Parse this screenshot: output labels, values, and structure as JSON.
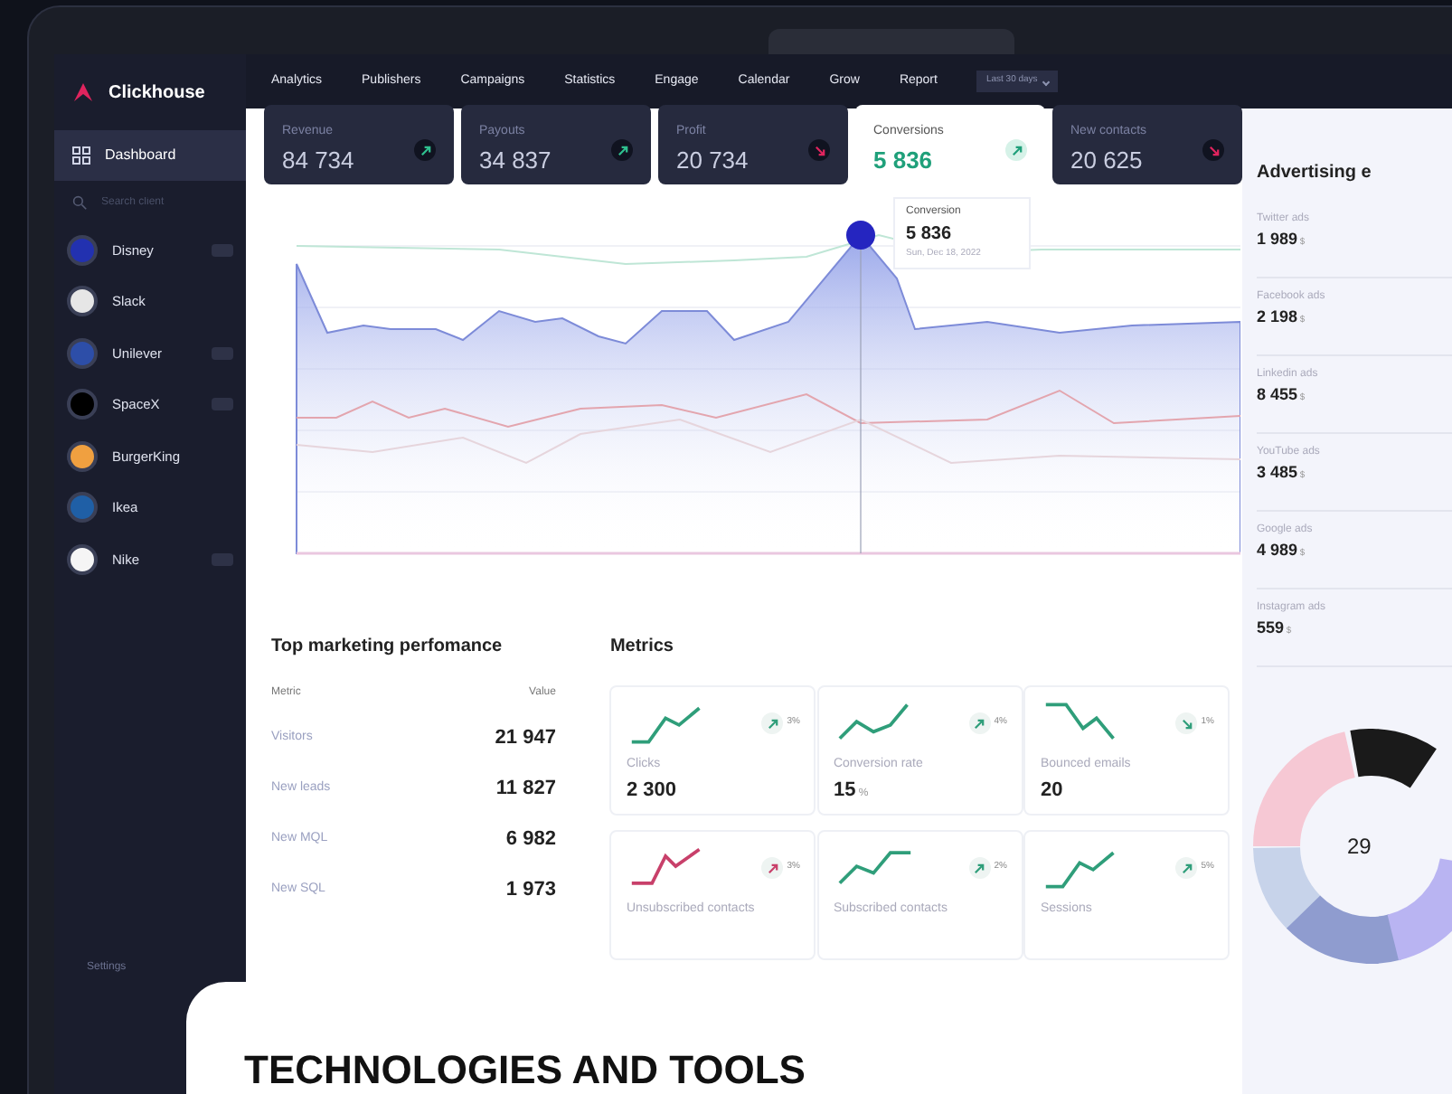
{
  "brand": "Clickhouse",
  "nav": [
    "Analytics",
    "Publishers",
    "Campaigns",
    "Statistics",
    "Engage",
    "Calendar",
    "Grow",
    "Report"
  ],
  "range_dropdown": "Last 30 days",
  "sidebar": {
    "items": [
      {
        "label": "Dashboard",
        "kind": "nav",
        "selected": true
      },
      {
        "placeholder": "Search client",
        "kind": "search"
      },
      {
        "label": "Disney",
        "kind": "client",
        "color": "#2231b0",
        "badge": true
      },
      {
        "label": "Slack",
        "kind": "client",
        "color": "#e6e6e6",
        "badge": false
      },
      {
        "label": "Unilever",
        "kind": "client",
        "color": "#2d4ea8",
        "badge": true
      },
      {
        "label": "SpaceX",
        "kind": "client",
        "color": "#000000",
        "badge": true
      },
      {
        "label": "BurgerKing",
        "kind": "client",
        "color": "#f0a040",
        "badge": false
      },
      {
        "label": "Ikea",
        "kind": "client",
        "color": "#1f5fa6",
        "badge": false
      },
      {
        "label": "Nike",
        "kind": "client",
        "color": "#f5f5f5",
        "badge": true
      }
    ],
    "footer": "Settings"
  },
  "kpi_tabs": [
    {
      "label": "Revenue",
      "value": "84 734",
      "kind": "up",
      "selected": false
    },
    {
      "label": "Payouts",
      "value": "34 837",
      "kind": "up",
      "selected": false
    },
    {
      "label": "Profit",
      "value": "20 734",
      "kind": "down",
      "selected": false
    },
    {
      "label": "Conversions",
      "value": "5 836",
      "kind": "up",
      "selected": true
    },
    {
      "label": "New contacts",
      "value": "20 625",
      "kind": "down",
      "selected": false
    }
  ],
  "tooltip": {
    "label": "Conversion",
    "value": "5 836",
    "date": "Sun, Dec 18, 2022"
  },
  "top_marketing": {
    "title": "Top marketing perfomance",
    "columns": [
      "Metric",
      "Value"
    ],
    "rows": [
      [
        "Visitors",
        "21 947"
      ],
      [
        "New leads",
        "11 827"
      ],
      [
        "New MQL",
        "6 982"
      ],
      [
        "New SQL",
        "1 973"
      ]
    ]
  },
  "metrics": {
    "title": "Metrics",
    "cards": [
      {
        "label": "Clicks",
        "value": "2 300",
        "change": "3%",
        "kind": "up",
        "color": "#2f9e7a"
      },
      {
        "label": "Conversion rate",
        "value": "15",
        "unit": "%",
        "change": "4%",
        "kind": "up",
        "color": "#2f9e7a"
      },
      {
        "label": "Bounced emails",
        "value": "20",
        "change": "1%",
        "kind": "down",
        "color": "#2f9e7a"
      },
      {
        "label": "Unsubscribed contacts",
        "change": "3%",
        "kind": "up",
        "color": "#c8406a"
      },
      {
        "label": "Subscribed contacts",
        "change": "2%",
        "kind": "up",
        "color": "#2f9e7a"
      },
      {
        "label": "Sessions",
        "change": "5%",
        "kind": "up",
        "color": "#2f9e7a"
      }
    ]
  },
  "advertising": {
    "title": "Advertising e",
    "items": [
      {
        "label": "Twitter ads",
        "value": "1 989",
        "unit": "$"
      },
      {
        "label": "Facebook ads",
        "value": "2 198",
        "unit": "$"
      },
      {
        "label": "Linkedin ads",
        "value": "8 455",
        "unit": "$"
      },
      {
        "label": "YouTube ads",
        "value": "3 485",
        "unit": "$"
      },
      {
        "label": "Google ads",
        "value": "4 989",
        "unit": "$"
      },
      {
        "label": "Instagram ads",
        "value": "559",
        "unit": "$"
      }
    ],
    "donut_center": "29"
  },
  "overlay": {
    "title": "TECHNOLOGIES AND TOOLS"
  }
}
